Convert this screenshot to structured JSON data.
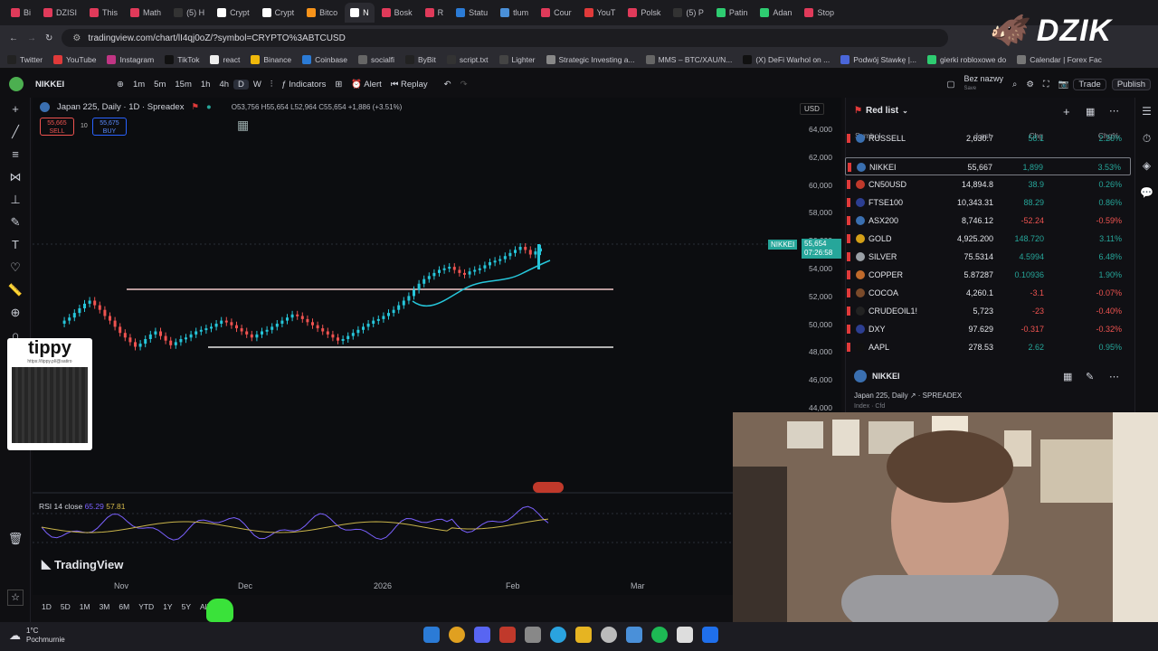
{
  "browser": {
    "tabs": [
      "Bi",
      "DZISI",
      "This",
      "Math",
      "(5) H",
      "Crypt",
      "Crypt",
      "Bitco",
      "N",
      "Bosk",
      "R",
      "Statu",
      "tlum",
      "Cour",
      "YouT",
      "Polsk",
      "(5) P",
      "Patin",
      "Adan",
      "Stop"
    ],
    "url": "tradingview.com/chart/lI4qj0oZ/?symbol=CRYPTO%3ABTCUSD",
    "bookmarks": [
      "Twitter",
      "YouTube",
      "Instagram",
      "TikTok",
      "react",
      "Binance",
      "Coinbase",
      "socialfi",
      "ByBit",
      "script.txt",
      "Lighter",
      "Strategic Investing a...",
      "MMS – BTC/XAU/N...",
      "(X) DeFi Warhol on ...",
      "Podwój Stawkę |...",
      "gierki robloxowe do",
      "Calendar | Forex Fac"
    ]
  },
  "toolbar": {
    "symbol": "NIKKEI",
    "intervals": [
      "1m",
      "5m",
      "15m",
      "1h",
      "4h",
      "D",
      "W"
    ],
    "indicators": "Indicators",
    "alert": "Alert",
    "replay": "Replay",
    "layout_name": "Bez nazwy",
    "layout_sub": "Save",
    "trade": "Trade",
    "publish": "Publish"
  },
  "chart": {
    "title": "Japan 225, Daily · 1D · Spreadex",
    "ohlc": "O53,756 H55,654 L52,964 C55,654 +1,886 (+3.51%)",
    "sell_price": "55,665",
    "sell_label": "SELL",
    "spread": "10",
    "buy_price": "55,675",
    "buy_label": "BUY",
    "currency": "USD",
    "yticks": [
      "64,000",
      "62,000",
      "60,000",
      "58,000",
      "56,000",
      "54,000",
      "52,000",
      "50,000",
      "48,000",
      "46,000",
      "44,000"
    ],
    "price_label_symbol": "NIKKEI",
    "price_label_value": "55,654",
    "price_label_time": "07:26:58",
    "xticks": [
      "Nov",
      "Dec",
      "2026",
      "Feb",
      "Mar"
    ],
    "rsi_label": "RSI 14 close",
    "rsi_val1": "65.29",
    "rsi_val2": "57.81",
    "ranges": [
      "1D",
      "5D",
      "1M",
      "3M",
      "6M",
      "YTD",
      "1Y",
      "5Y",
      "All"
    ],
    "brand": "TradingView"
  },
  "watchlist": {
    "title": "Red list",
    "columns": [
      "Symbol",
      "Last",
      "Chg",
      "Chg%"
    ],
    "rows": [
      {
        "symbol": "RUSSELL",
        "last": "2,630.7",
        "chg": "58.1",
        "pct": "2.26%",
        "dir": "up",
        "color": "#3a6fb0"
      },
      {
        "symbol": "NIKKEI",
        "last": "55,667",
        "chg": "1,899",
        "pct": "3.53%",
        "dir": "up",
        "color": "#3a6fb0"
      },
      {
        "symbol": "CN50USD",
        "last": "14,894.8",
        "chg": "38.9",
        "pct": "0.26%",
        "dir": "up",
        "color": "#c0392b"
      },
      {
        "symbol": "FTSE100",
        "last": "10,343.31",
        "chg": "88.29",
        "pct": "0.86%",
        "dir": "up",
        "color": "#2c3e91"
      },
      {
        "symbol": "ASX200",
        "last": "8,746.12",
        "chg": "-52.24",
        "pct": "-0.59%",
        "dir": "dn",
        "color": "#3a6fb0"
      },
      {
        "symbol": "GOLD",
        "last": "4,925.200",
        "chg": "148.720",
        "pct": "3.11%",
        "dir": "up",
        "color": "#d4a017"
      },
      {
        "symbol": "SILVER",
        "last": "75.5314",
        "chg": "4.5994",
        "pct": "6.48%",
        "dir": "up",
        "color": "#9aa0a6"
      },
      {
        "symbol": "COPPER",
        "last": "5.87287",
        "chg": "0.10936",
        "pct": "1.90%",
        "dir": "up",
        "color": "#c06a2b"
      },
      {
        "symbol": "COCOA",
        "last": "4,260.1",
        "chg": "-3.1",
        "pct": "-0.07%",
        "dir": "dn",
        "color": "#7a4a2a"
      },
      {
        "symbol": "CRUDEOIL1!",
        "last": "5,723",
        "chg": "-23",
        "pct": "-0.40%",
        "dir": "dn",
        "color": "#222222"
      },
      {
        "symbol": "DXY",
        "last": "97.629",
        "chg": "-0.317",
        "pct": "-0.32%",
        "dir": "dn",
        "color": "#2c3e91"
      },
      {
        "symbol": "AAPL",
        "last": "278.53",
        "chg": "2.62",
        "pct": "0.95%",
        "dir": "up",
        "color": "#111111"
      }
    ],
    "detail_symbol": "NIKKEI",
    "detail_desc": "Japan 225, Daily",
    "detail_source": "SPREADEX",
    "detail_type": "Index · Cfd"
  },
  "overlay": {
    "tippy_title": "tippy",
    "tippy_url": "https://tippy.pl/@satiro",
    "brand_logo": "DZIK"
  },
  "taskbar": {
    "temp": "1°C",
    "weather": "Pochmurnie"
  }
}
